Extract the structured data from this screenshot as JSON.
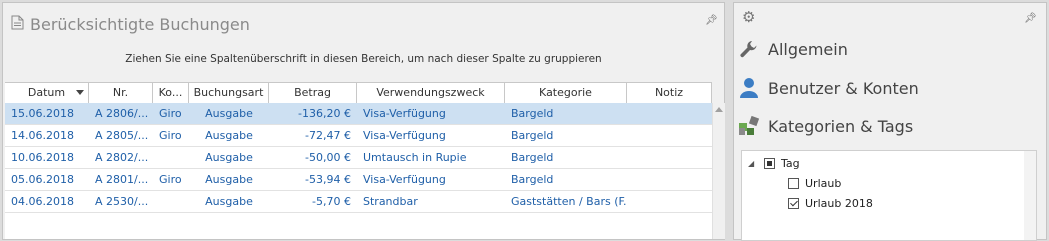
{
  "left_panel": {
    "title": "Berücksichtigte Buchungen",
    "pin_icon": "pin-icon",
    "group_hint": "Ziehen Sie eine Spaltenüberschrift in diesen Bereich, um nach dieser Spalte zu gruppieren",
    "columns": [
      "Datum",
      "Nr.",
      "Ko...",
      "Buchungsart",
      "Betrag",
      "Verwendungszweck",
      "Kategorie",
      "Notiz"
    ],
    "sorted_column": "Datum",
    "rows": [
      {
        "datum": "15.06.2018",
        "nr": "A 2806/...",
        "konto": "Giro",
        "art": "Ausgabe",
        "betrag": "-136,20 €",
        "zweck": "Visa-Verfügung",
        "kategorie": "Bargeld",
        "notiz": "",
        "selected": true
      },
      {
        "datum": "14.06.2018",
        "nr": "A 2805/...",
        "konto": "Giro",
        "art": "Ausgabe",
        "betrag": "-72,47 €",
        "zweck": "Visa-Verfügung",
        "kategorie": "Bargeld",
        "notiz": "",
        "selected": false
      },
      {
        "datum": "10.06.2018",
        "nr": "A 2802/...",
        "konto": "",
        "art": "Ausgabe",
        "betrag": "-50,00 €",
        "zweck": "Umtausch in Rupie",
        "kategorie": "Bargeld",
        "notiz": "",
        "selected": false
      },
      {
        "datum": "05.06.2018",
        "nr": "A 2801/...",
        "konto": "Giro",
        "art": "Ausgabe",
        "betrag": "-53,94 €",
        "zweck": "Visa-Verfügung",
        "kategorie": "Bargeld",
        "notiz": "",
        "selected": false
      },
      {
        "datum": "04.06.2018",
        "nr": "A 2530/...",
        "konto": "",
        "art": "Ausgabe",
        "betrag": "-5,70 €",
        "zweck": "Strandbar",
        "kategorie": "Gaststätten / Bars (F...",
        "notiz": "",
        "selected": false
      }
    ]
  },
  "right_panel": {
    "pin_icon": "pin-icon",
    "nav": [
      {
        "label": "Allgemein",
        "icon": "wrench-icon"
      },
      {
        "label": "Benutzer & Konten",
        "icon": "user-icon"
      },
      {
        "label": "Kategorien & Tags",
        "icon": "categories-icon"
      }
    ],
    "tree": {
      "root": {
        "label": "Tag",
        "state": "partial"
      },
      "children": [
        {
          "label": "Urlaub",
          "state": "unchecked"
        },
        {
          "label": "Urlaub 2018",
          "state": "checked"
        }
      ]
    }
  },
  "colors": {
    "link_text": "#1f5fa8",
    "selected_row": "#cde0f2",
    "panel_bg": "#f0f0f0"
  }
}
